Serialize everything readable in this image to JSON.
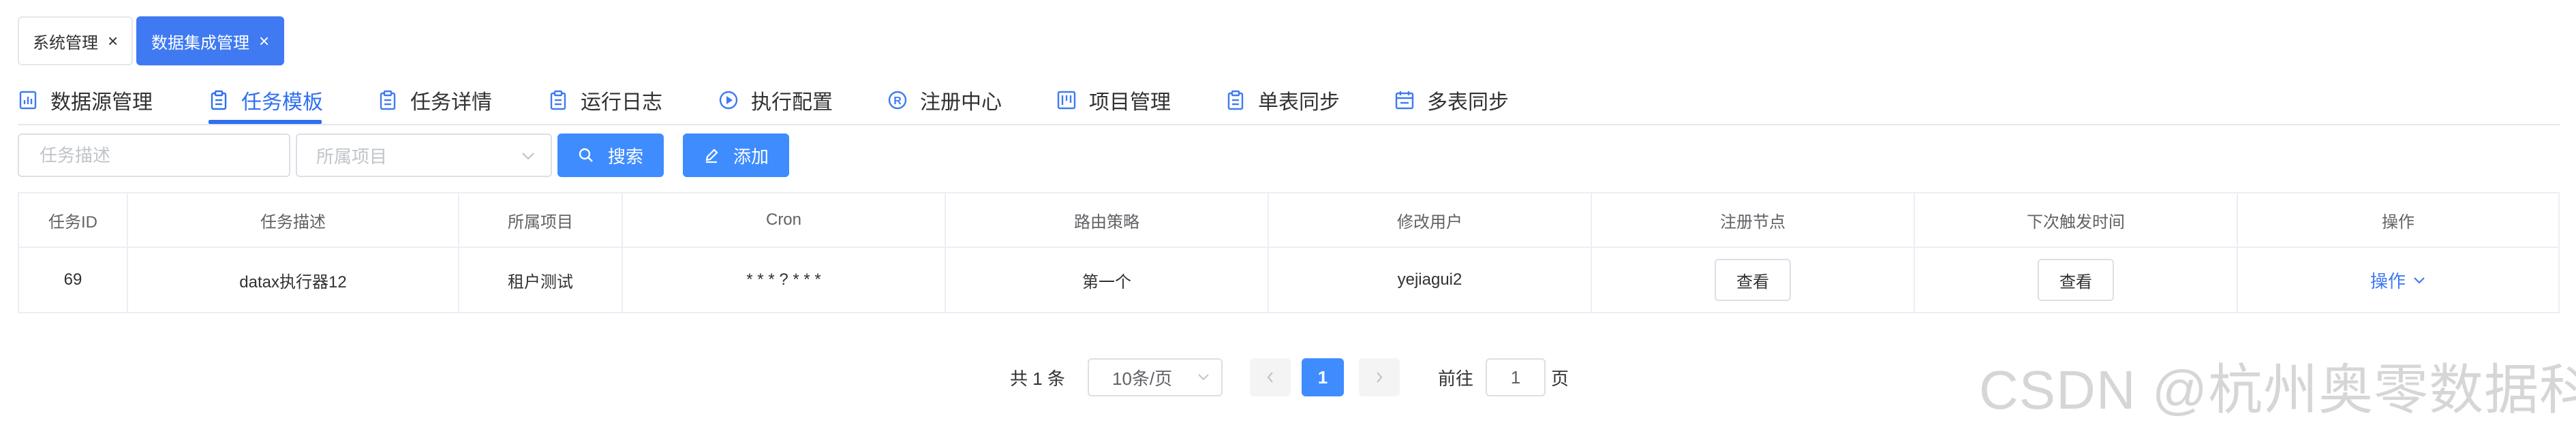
{
  "tags": [
    {
      "label": "系统管理",
      "close": "×"
    },
    {
      "label": "数据集成管理",
      "close": "×"
    }
  ],
  "tabs": [
    {
      "label": "数据源管理",
      "icon": "chart-icon"
    },
    {
      "label": "任务模板",
      "icon": "clipboard-icon",
      "active": true
    },
    {
      "label": "任务详情",
      "icon": "clipboard-icon"
    },
    {
      "label": "运行日志",
      "icon": "clipboard-icon"
    },
    {
      "label": "执行配置",
      "icon": "play-circle-icon"
    },
    {
      "label": "注册中心",
      "icon": "registered-icon"
    },
    {
      "label": "项目管理",
      "icon": "kanban-icon"
    },
    {
      "label": "单表同步",
      "icon": "clipboard-icon"
    },
    {
      "label": "多表同步",
      "icon": "calendar-icon"
    }
  ],
  "filters": {
    "desc_placeholder": "任务描述",
    "project_placeholder": "所属项目",
    "search_label": "搜索",
    "add_label": "添加"
  },
  "table": {
    "columns": [
      "任务ID",
      "任务描述",
      "所属项目",
      "Cron",
      "路由策略",
      "修改用户",
      "注册节点",
      "下次触发时间",
      "操作"
    ],
    "rows": [
      {
        "id": "69",
        "desc": "datax执行器12",
        "project": "租户测试",
        "cron": "* * * ? * * *",
        "route": "第一个",
        "user": "yejiagui2",
        "node": "查看",
        "next": "查看",
        "op": "操作"
      }
    ]
  },
  "pagination": {
    "total": "共 1 条",
    "page_size": "10条/页",
    "current": "1",
    "goto_prefix": "前往",
    "goto_value": "1",
    "goto_suffix": "页"
  },
  "watermark": "CSDN @杭州奥零数据科技",
  "colors": {
    "primary": "#3f7af2",
    "button": "#3f8cff",
    "border": "#ebeef5"
  }
}
